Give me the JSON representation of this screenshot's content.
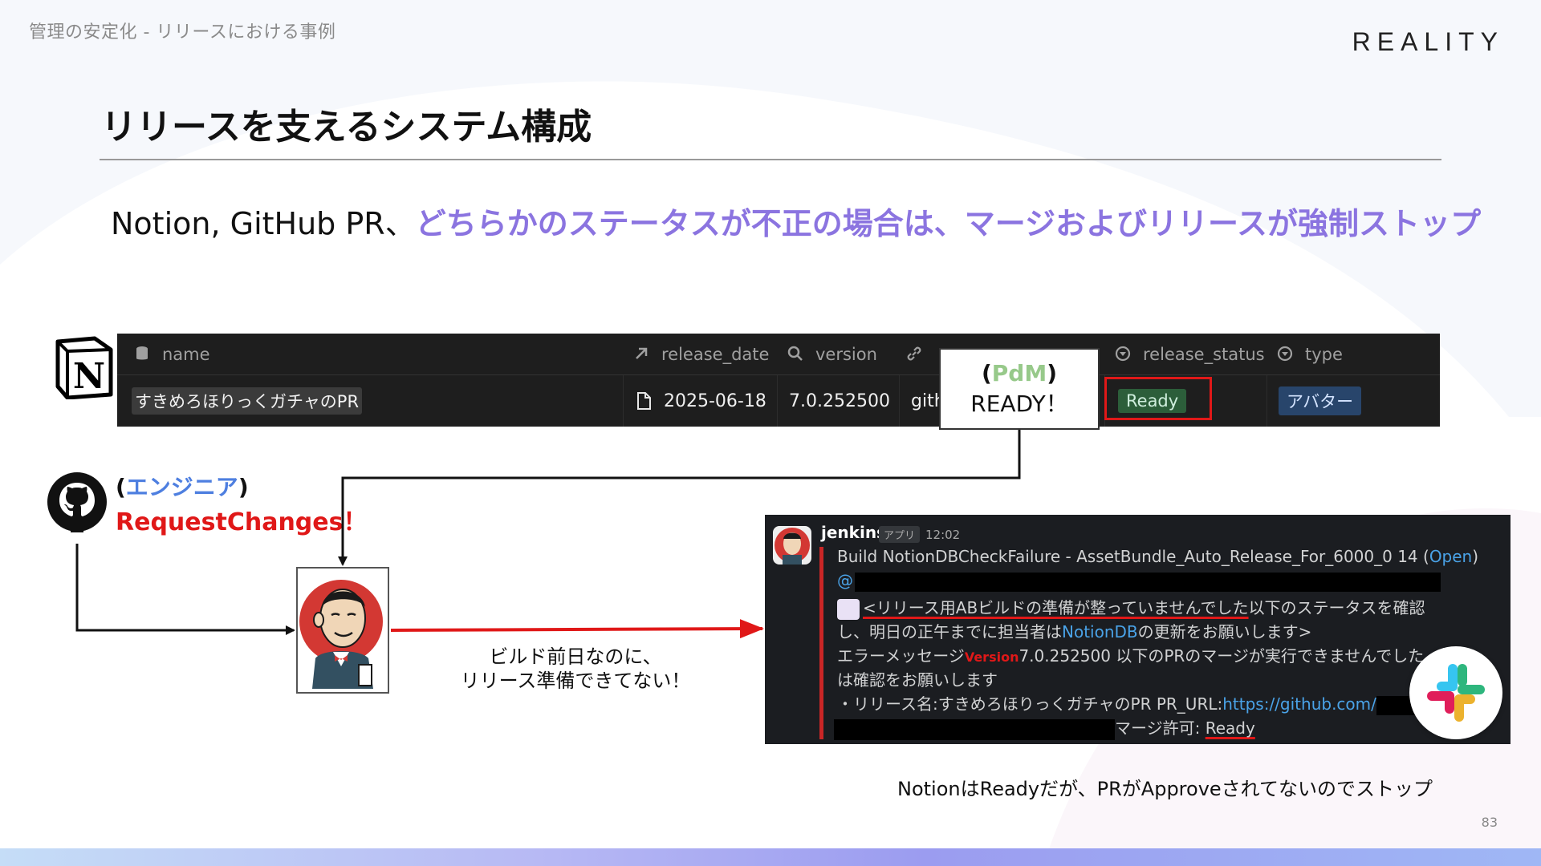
{
  "breadcrumb": "管理の安定化 - リリースにおける事例",
  "brand": "REALITY",
  "title": "リリースを支えるシステム構成",
  "subtitle": {
    "prefix": "Notion, GitHub PR、",
    "highlight": "どちらかのステータスが不正の場合は、マージおよびリリースが強制ストップ"
  },
  "notion_table": {
    "headers": {
      "name": "name",
      "release_date": "release_date",
      "version": "version",
      "link": "",
      "release_status": "release_status",
      "type": "type"
    },
    "row": {
      "name": "すきめろほりっくガチャのPR",
      "release_date": "2025-06-18",
      "version": "7.0.252500",
      "link": "githu",
      "release_status": "Ready",
      "type": "アバター"
    }
  },
  "pdm_callout": {
    "open_paren": "(",
    "role": "PdM",
    "close_paren": ")",
    "text": "READY！"
  },
  "github": {
    "open_paren": "(",
    "role": "エンジニア",
    "close_paren": ")",
    "status": "RequestChanges！"
  },
  "arrow_caption": {
    "line1": "ビルド前日なのに、",
    "line2": "リリース準備できてない！"
  },
  "slack": {
    "sender": "jenkins",
    "app_badge": "アプリ",
    "time": "12:02",
    "build_line": "Build NotionDBCheckFailure - AssetBundle_Auto_Release_For_6000_0 14 (",
    "build_link": "Open",
    "build_close": ")",
    "mention": "@",
    "msg1_underlined": "<リリース用ABビルドの準備が整っていませんでした",
    "msg1_rest": "以下のステータスを確認",
    "msg2_prefix": "し、明日の正午までに担当者は",
    "msg2_link": "NotionDB",
    "msg2_suffix": "の更新をお願いします>",
    "msg3_prefix": "エラーメッセージ",
    "msg3_tag": "Version",
    "msg3_suffix": "7.0.252500 以下のPRのマージが実行できませんでした。担当",
    "msg4": "は確認をお願いします",
    "msg5_prefix": "・リリース名:すきめろほりっくガチャのPR PR_URL:",
    "msg5_link": "https://github.com/",
    "msg6_prefix": "マージ許可: ",
    "msg6_status": "Ready"
  },
  "footer_note": "NotionはReadyだが、PRがApproveされてないのでストップ",
  "page_number": "83",
  "colors": {
    "highlight": "#8b74e0",
    "alert_red": "#e01818",
    "engineer_blue": "#4e7fe0",
    "pdm_green": "#97c98a",
    "slack_bg": "#1b1d21",
    "notion_bg": "#1e1e1e"
  },
  "icons": {
    "notion_logo": "notion-logo",
    "github_logo": "github-logo",
    "jenkins_mascot": "jenkins-mascot",
    "slack_logo": "slack-logo"
  }
}
